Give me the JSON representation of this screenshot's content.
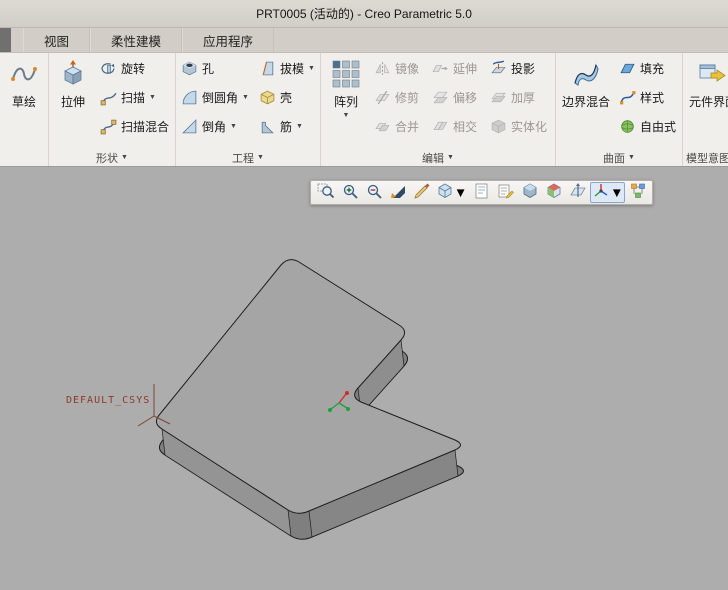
{
  "window": {
    "title": "PRT0005 (活动的) - Creo Parametric 5.0"
  },
  "menu_tabs": {
    "items": [
      {
        "label": "视图"
      },
      {
        "label": "柔性建模"
      },
      {
        "label": "应用程序"
      }
    ]
  },
  "ribbon": {
    "sketch_button": {
      "label": "草绘"
    },
    "shapes_group": {
      "label": "形状",
      "extrude": {
        "label": "拉伸"
      },
      "revolve": {
        "label": "旋转"
      },
      "sweep": {
        "label": "扫描",
        "has_dropdown": true
      },
      "swept_blend": {
        "label": "扫描混合"
      }
    },
    "engineering_group": {
      "label": "工程",
      "hole": {
        "label": "孔"
      },
      "round": {
        "label": "倒圆角",
        "has_dropdown": true
      },
      "chamfer": {
        "label": "倒角",
        "has_dropdown": true
      },
      "draft": {
        "label": "拔模",
        "has_dropdown": true
      },
      "shell": {
        "label": "壳"
      },
      "rib": {
        "label": "筋",
        "has_dropdown": true
      }
    },
    "editing_group": {
      "label": "编辑",
      "pattern": {
        "label": "阵列",
        "has_dropdown": true
      },
      "mirror": {
        "label": "镜像",
        "enabled": false
      },
      "trim": {
        "label": "修剪",
        "enabled": false
      },
      "merge": {
        "label": "合并",
        "enabled": false
      },
      "extend": {
        "label": "延伸",
        "enabled": false
      },
      "offset": {
        "label": "偏移",
        "enabled": false
      },
      "intersect": {
        "label": "相交",
        "enabled": false
      },
      "project": {
        "label": "投影",
        "enabled": true
      },
      "thicken": {
        "label": "加厚",
        "enabled": false
      },
      "solidify": {
        "label": "实体化",
        "enabled": false
      }
    },
    "surfaces_group": {
      "label": "曲面",
      "boundary_blend": {
        "label": "边界混合"
      },
      "fill": {
        "label": "填充"
      },
      "style": {
        "label": "样式"
      },
      "freestyle": {
        "label": "自由式"
      }
    },
    "model_intent_group": {
      "label": "模型意图",
      "component_interface": {
        "label": "元件界面"
      }
    }
  },
  "graphics_toolbar": {
    "icons": [
      {
        "name": "zoom-region-icon"
      },
      {
        "name": "zoom-in-icon"
      },
      {
        "name": "zoom-out-icon"
      },
      {
        "name": "refit-icon"
      },
      {
        "name": "repaint-icon"
      },
      {
        "name": "display-style-icon",
        "has_dropdown": true
      },
      {
        "name": "scene-sheet-icon"
      },
      {
        "name": "annotation-display-icon"
      },
      {
        "name": "shaded-view-icon"
      },
      {
        "name": "saved-orientations-icon"
      },
      {
        "name": "datum-display-filters-icon"
      },
      {
        "name": "spin-center-icon",
        "selected": true,
        "has_dropdown": true
      },
      {
        "name": "view-manager-icon"
      }
    ]
  },
  "viewport": {
    "csys_label": "DEFAULT_CSYS",
    "colors": {
      "background": "#adadad",
      "part_top": "#a5a5a5",
      "part_side_left": "#949494",
      "part_side_right": "#868686",
      "part_bottom": "#7f7f7f",
      "edge": "#1c1c1c",
      "csys_text": "#8a3b2a",
      "axis_red": "#d42a2a",
      "axis_green": "#1fa03f"
    }
  }
}
